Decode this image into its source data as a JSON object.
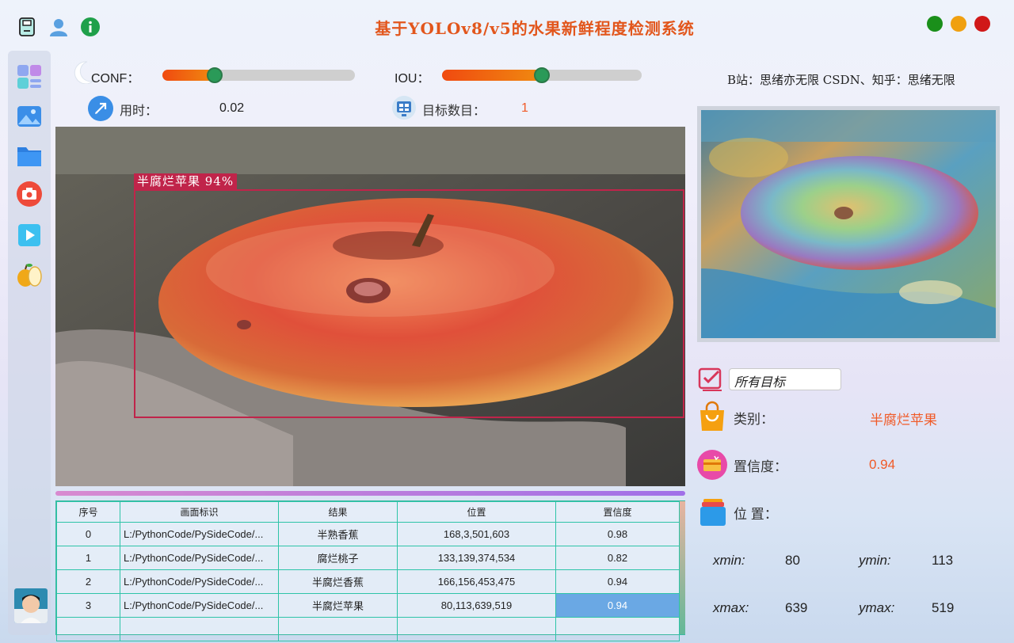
{
  "app": {
    "title": "基于YOLOv8/v5的水果新鲜程度检测系统",
    "credit": "B站：思绪亦无限  CSDN、知乎：思绪无限"
  },
  "top_icons": [
    "save-icon",
    "user-icon",
    "info-icon"
  ],
  "window_controls": {
    "colors": [
      "#1a8f1a",
      "#f0a010",
      "#d01818"
    ]
  },
  "sidebar": {
    "items": [
      {
        "name": "dashboard-icon"
      },
      {
        "name": "image-icon"
      },
      {
        "name": "folder-icon"
      },
      {
        "name": "camera-icon"
      },
      {
        "name": "video-icon"
      },
      {
        "name": "fruit-model-icon"
      }
    ]
  },
  "controls": {
    "conf_label": "CONF：",
    "conf_value": 0.27,
    "iou_label": "IOU：",
    "iou_value": 0.5,
    "time_label": "用时：",
    "time_value": "0.02",
    "count_label": "目标数目：",
    "count_value": "1"
  },
  "detection": {
    "label": "半腐烂苹果  94%",
    "box_color": "#c0244a"
  },
  "table": {
    "headers": [
      "序号",
      "画面标识",
      "结果",
      "位置",
      "置信度"
    ],
    "rows": [
      [
        "0",
        "L:/PythonCode/PySideCode/...",
        "半熟香蕉",
        "168,3,501,603",
        "0.98"
      ],
      [
        "1",
        "L:/PythonCode/PySideCode/...",
        "腐烂桃子",
        "133,139,374,534",
        "0.82"
      ],
      [
        "2",
        "L:/PythonCode/PySideCode/...",
        "半腐烂香蕉",
        "166,156,453,475",
        "0.94"
      ],
      [
        "3",
        "L:/PythonCode/PySideCode/...",
        "半腐烂苹果",
        "80,113,639,519",
        "0.94"
      ]
    ],
    "selected_row": 3
  },
  "result_panel": {
    "target_select": "所有目标",
    "class_label": "类别：",
    "class_value": "半腐烂苹果",
    "conf_label": "置信度：",
    "conf_value": "0.94",
    "pos_label": "位 置：",
    "xmin_label": "xmin:",
    "xmin": "80",
    "ymin_label": "ymin:",
    "ymin": "113",
    "xmax_label": "xmax:",
    "xmax": "639",
    "ymax_label": "ymax:",
    "ymax": "519"
  }
}
